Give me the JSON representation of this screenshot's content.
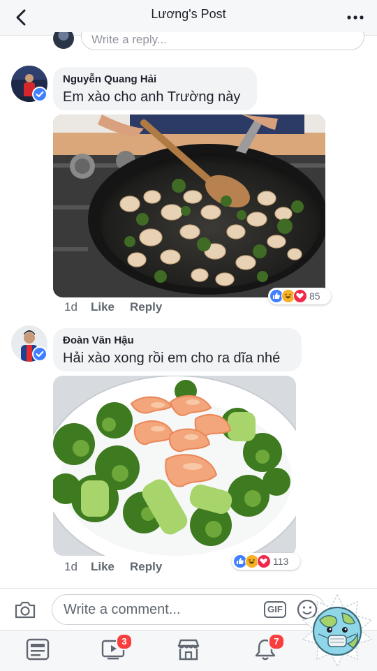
{
  "header": {
    "title": "Lương's Post"
  },
  "reply_box": {
    "placeholder": "Write a reply..."
  },
  "comments": [
    {
      "author": "Nguyễn Quang Hải",
      "text": "Em xào cho anh Trường này",
      "age": "1d",
      "like_label": "Like",
      "reply_label": "Reply",
      "reaction_count": "85",
      "reactions": [
        "like-icon",
        "haha-icon",
        "love-icon"
      ]
    },
    {
      "author": "Đoàn Văn Hậu",
      "text": "Hải xào xong rồi em cho ra dĩa nhé",
      "age": "1d",
      "like_label": "Like",
      "reply_label": "Reply",
      "reaction_count": "113",
      "reactions": [
        "like-icon",
        "haha-icon",
        "love-icon"
      ]
    }
  ],
  "composer": {
    "placeholder": "Write a comment...",
    "gif_label": "GIF"
  },
  "tabbar": {
    "tabs": [
      {
        "icon": "news-feed-icon",
        "badge": ""
      },
      {
        "icon": "watch-icon",
        "badge": "3"
      },
      {
        "icon": "marketplace-icon",
        "badge": ""
      },
      {
        "icon": "notifications-icon",
        "badge": "7"
      }
    ]
  },
  "colors": {
    "brand_blue": "#4080ff",
    "badge_red": "#fa3e3e",
    "bubble_bg": "#f2f3f5",
    "love_red": "#f0284a",
    "haha_yellow": "#f7b125"
  }
}
